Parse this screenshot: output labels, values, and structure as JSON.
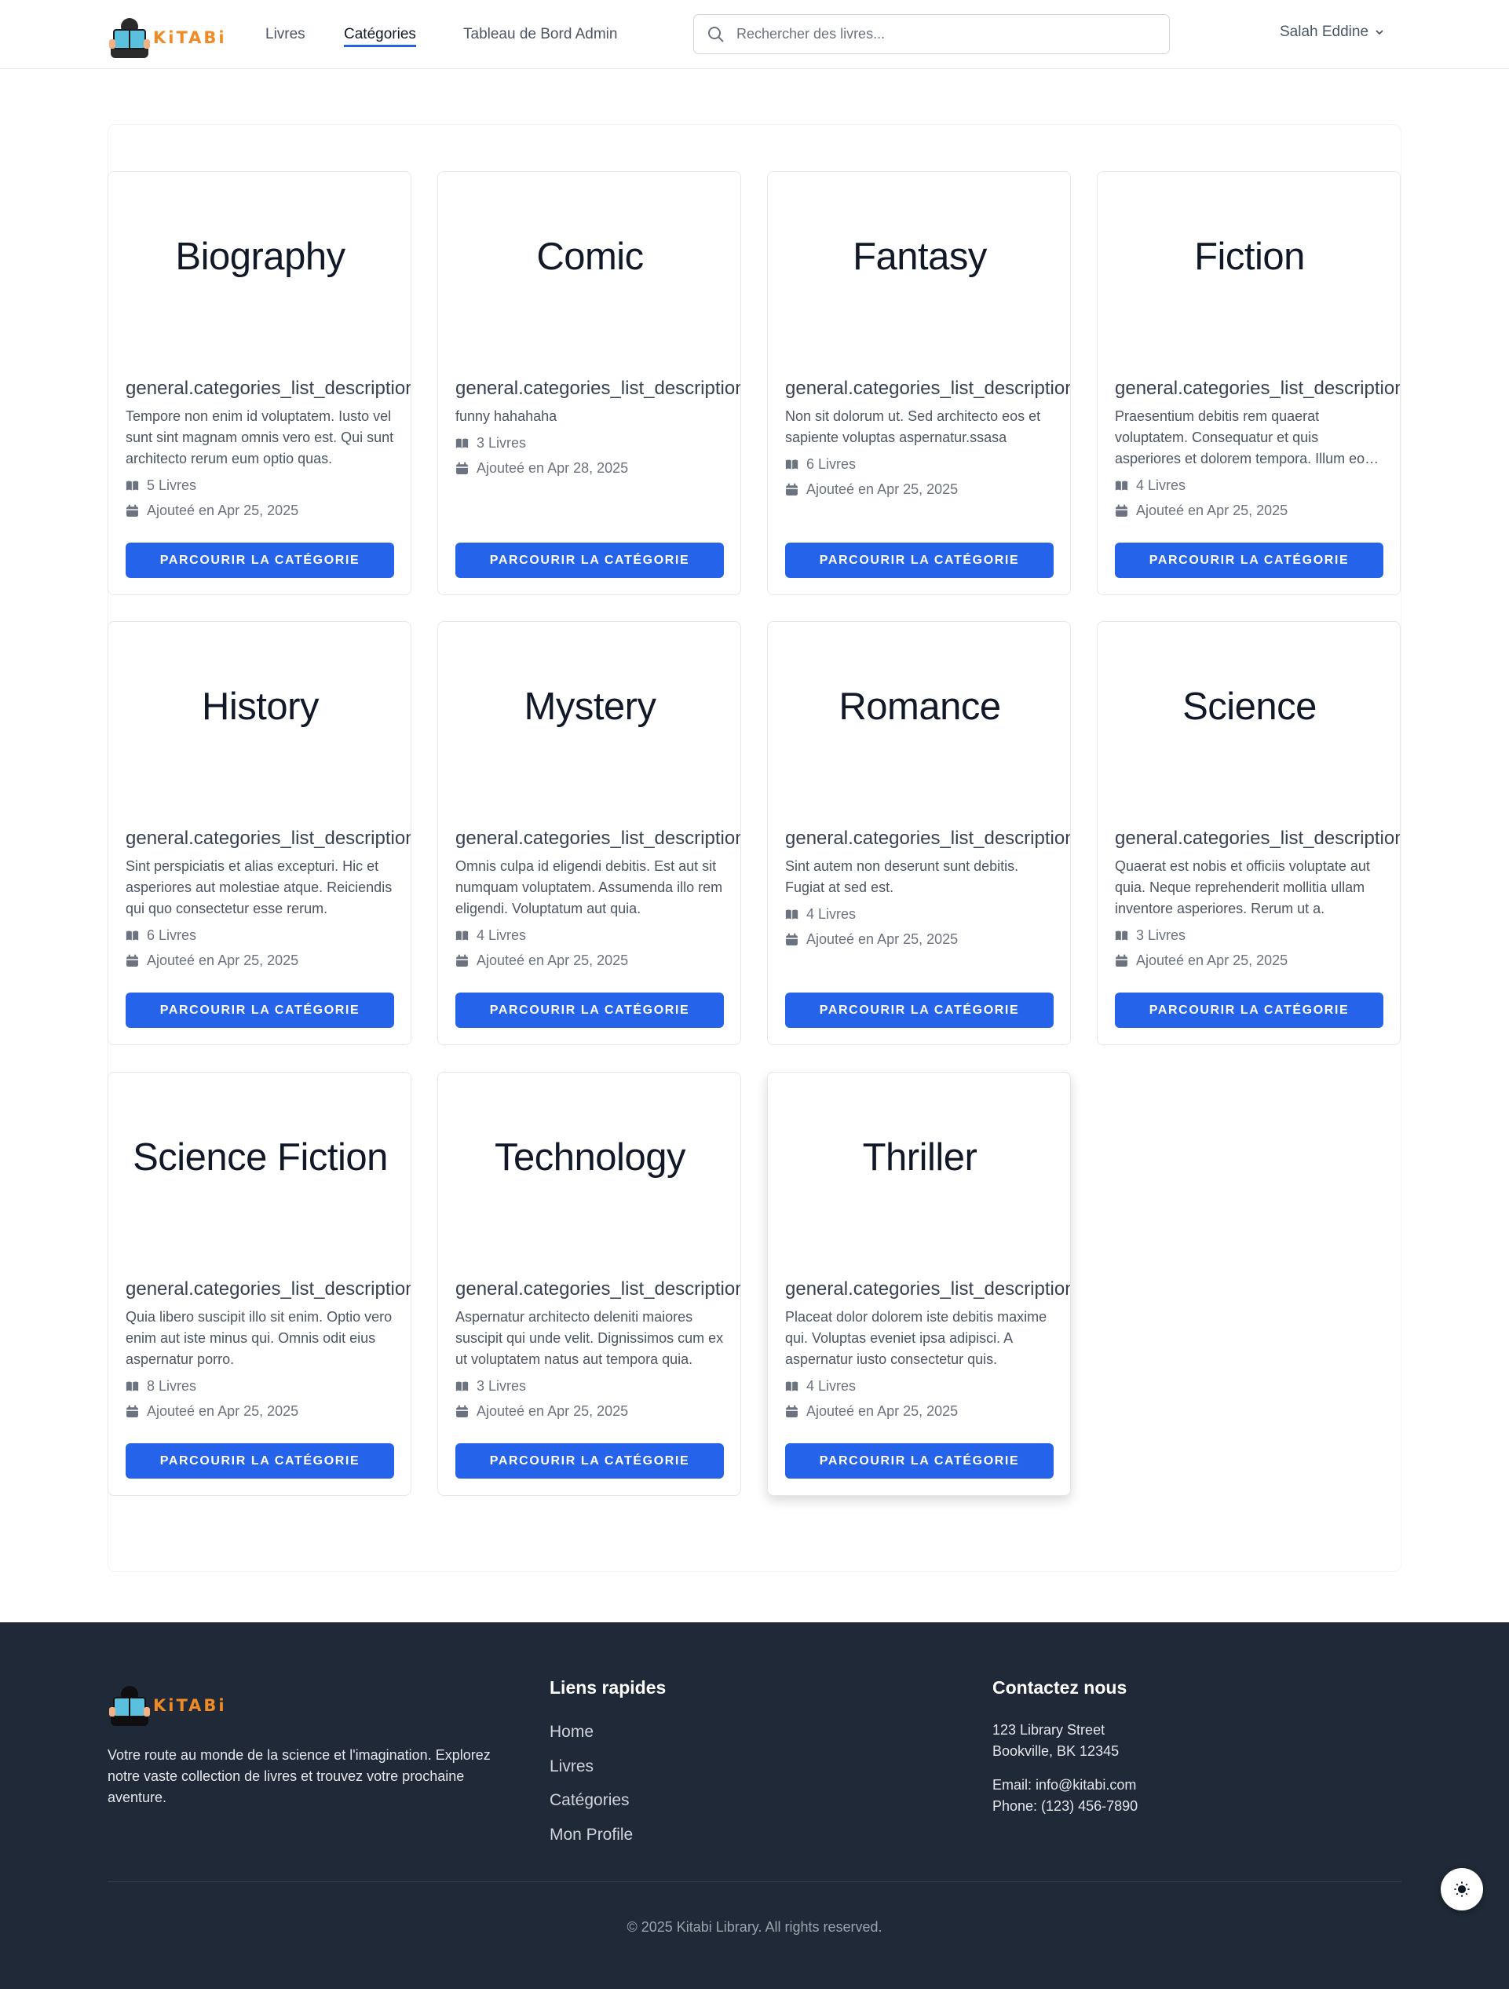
{
  "brand": {
    "name": "KiTABi",
    "colors": {
      "accent": "#2563eb",
      "brand_orange": "#f08a24",
      "footer_bg": "#1f2937"
    }
  },
  "header": {
    "nav": [
      {
        "label": "Livres",
        "active": false
      },
      {
        "label": "Catégories",
        "active": true
      },
      {
        "label": "Tableau de Bord Admin",
        "active": false
      }
    ],
    "search": {
      "placeholder": "Rechercher des livres...",
      "value": ""
    },
    "user": {
      "name": "Salah Eddine"
    }
  },
  "categories": [
    {
      "name": "Biography",
      "heading": "general.categories_list_description",
      "description": "Tempore non enim id voluptatem. Iusto vel sunt sint magnam omnis vero est. Qui sunt architecto rerum eum optio quas.",
      "books": "5 Livres",
      "added": "Ajouteé en Apr 25, 2025",
      "button": "PARCOURIR LA CATÉGORIE"
    },
    {
      "name": "Comic",
      "heading": "general.categories_list_description",
      "description": "funny hahahaha",
      "books": "3 Livres",
      "added": "Ajouteé en Apr 28, 2025",
      "button": "PARCOURIR LA CATÉGORIE"
    },
    {
      "name": "Fantasy",
      "heading": "general.categories_list_description",
      "description": "Non sit dolorum ut. Sed architecto eos et sapiente voluptas aspernatur.ssasa",
      "books": "6 Livres",
      "added": "Ajouteé en Apr 25, 2025",
      "button": "PARCOURIR LA CATÉGORIE"
    },
    {
      "name": "Fiction",
      "heading": "general.categories_list_description",
      "description": "Praesentium debitis rem quaerat voluptatem. Consequatur et quis asperiores et dolorem tempora. Illum eos aut.",
      "books": "4 Livres",
      "added": "Ajouteé en Apr 25, 2025",
      "button": "PARCOURIR LA CATÉGORIE"
    },
    {
      "name": "History",
      "heading": "general.categories_list_description",
      "description": "Sint perspiciatis et alias excepturi. Hic et asperiores aut molestiae atque. Reiciendis qui quo consectetur esse rerum.",
      "books": "6 Livres",
      "added": "Ajouteé en Apr 25, 2025",
      "button": "PARCOURIR LA CATÉGORIE"
    },
    {
      "name": "Mystery",
      "heading": "general.categories_list_description",
      "description": "Omnis culpa id eligendi debitis. Est aut sit numquam voluptatem. Assumenda illo rem eligendi. Voluptatum aut quia.",
      "books": "4 Livres",
      "added": "Ajouteé en Apr 25, 2025",
      "button": "PARCOURIR LA CATÉGORIE"
    },
    {
      "name": "Romance",
      "heading": "general.categories_list_description",
      "description": "Sint autem non deserunt sunt debitis. Fugiat at sed est.",
      "books": "4 Livres",
      "added": "Ajouteé en Apr 25, 2025",
      "button": "PARCOURIR LA CATÉGORIE"
    },
    {
      "name": "Science",
      "heading": "general.categories_list_description",
      "description": "Quaerat est nobis et officiis voluptate aut quia. Neque reprehenderit mollitia ullam inventore asperiores. Rerum ut a.",
      "books": "3 Livres",
      "added": "Ajouteé en Apr 25, 2025",
      "button": "PARCOURIR LA CATÉGORIE"
    },
    {
      "name": "Science Fiction",
      "heading": "general.categories_list_description",
      "description": "Quia libero suscipit illo sit enim. Optio vero enim aut iste minus qui. Omnis odit eius aspernatur porro.",
      "books": "8 Livres",
      "added": "Ajouteé en Apr 25, 2025",
      "button": "PARCOURIR LA CATÉGORIE"
    },
    {
      "name": "Technology",
      "heading": "general.categories_list_description",
      "description": "Aspernatur architecto deleniti maiores suscipit qui unde velit. Dignissimos cum ex ut voluptatem natus aut tempora quia.",
      "books": "3 Livres",
      "added": "Ajouteé en Apr 25, 2025",
      "button": "PARCOURIR LA CATÉGORIE"
    },
    {
      "name": "Thriller",
      "heading": "general.categories_list_description",
      "description": "Placeat dolor dolorem iste debitis maxime qui. Voluptas eveniet ipsa adipisci. A aspernatur iusto consectetur quis.",
      "books": "4 Livres",
      "added": "Ajouteé en Apr 25, 2025",
      "button": "PARCOURIR LA CATÉGORIE"
    }
  ],
  "footer": {
    "about": "Votre route au monde de la science et l'imagination. Explorez notre vaste collection de livres et trouvez votre prochaine aventure.",
    "quick_links_title": "Liens rapides",
    "quick_links": [
      "Home",
      "Livres",
      "Catégories",
      "Mon Profile"
    ],
    "contact_title": "Contactez nous",
    "address_line1": "123 Library Street",
    "address_line2": "Bookville, BK 12345",
    "email": "Email: info@kitabi.com",
    "phone": "Phone: (123) 456-7890",
    "copyright": "© 2025 Kitabi Library. All rights reserved."
  },
  "icons": {
    "logo": "reading-person-logo-icon",
    "search": "search-icon",
    "user_menu": "chevron-down-icon",
    "books": "open-book-icon",
    "date": "calendar-icon",
    "theme": "sun-icon"
  }
}
